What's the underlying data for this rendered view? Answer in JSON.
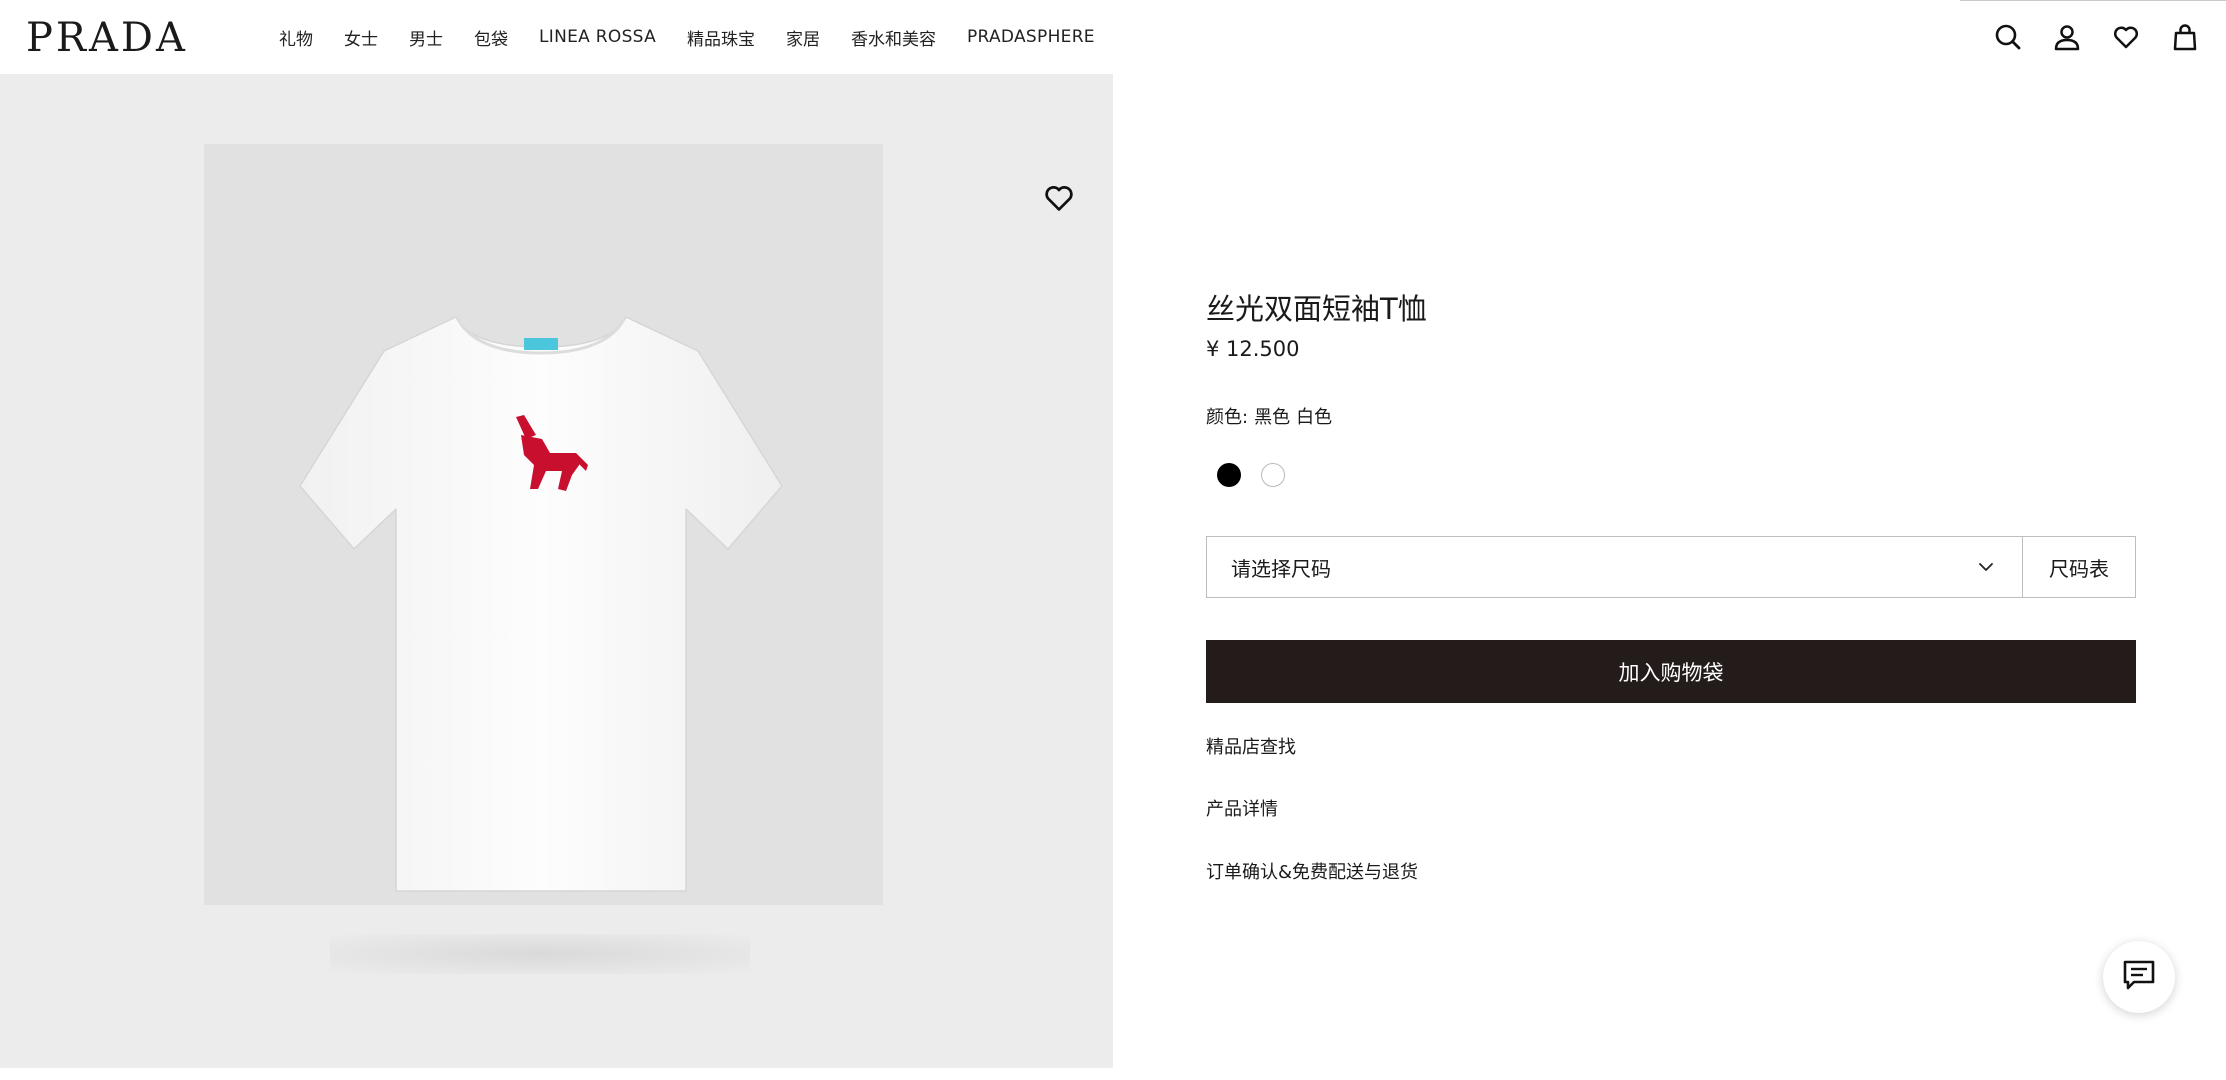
{
  "header": {
    "logo": "PRADA",
    "nav": [
      "礼物",
      "女士",
      "男士",
      "包袋",
      "LINEA ROSSA",
      "精品珠宝",
      "家居",
      "香水和美容",
      "PRADASPHERE"
    ],
    "icons": [
      "search-icon",
      "account-icon",
      "wishlist-icon",
      "shopping-bag-icon"
    ]
  },
  "product": {
    "title": "丝光双面短袖T恤",
    "price": "¥ 12.500",
    "color_label": "颜色:",
    "color_values": [
      "黑色",
      "白色"
    ],
    "swatches": [
      {
        "name": "black",
        "color": "#000000"
      },
      {
        "name": "white",
        "color": "#ffffff"
      }
    ],
    "size_placeholder": "请选择尺码",
    "size_chart": "尺码表",
    "add_to_bag": "加入购物袋",
    "links": [
      "精品店查找",
      "产品详情",
      "订单确认&免费配送与退货"
    ]
  },
  "colors": {
    "button_bg": "#231c1a",
    "gallery_bg": "#ececec",
    "logo_red": "#c8102e",
    "label_blue": "#4cc6dc"
  }
}
